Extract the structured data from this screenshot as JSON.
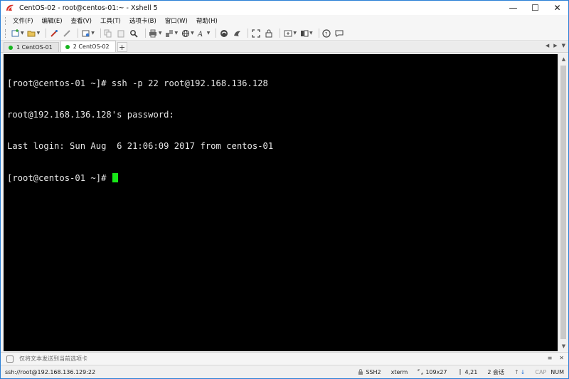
{
  "window": {
    "title": "CentOS-02 - root@centos-01:~ - Xshell 5",
    "controls": {
      "minimize": "—",
      "maximize": "☐",
      "close": "✕"
    }
  },
  "menu": [
    "文件(F)",
    "编辑(E)",
    "查看(V)",
    "工具(T)",
    "选项卡(B)",
    "窗口(W)",
    "帮助(H)"
  ],
  "toolbar": {
    "icons": [
      "new-session-icon",
      "open-folder-icon",
      "reconnect-icon",
      "disconnect-icon",
      "properties-icon",
      "copy-icon",
      "paste-icon",
      "find-icon",
      "print-icon",
      "transfer-icon",
      "globe-icon",
      "font-icon",
      "xftp-icon",
      "script-icon",
      "fullscreen-icon",
      "lock-icon",
      "new-tab-icon",
      "layout-icon",
      "help-icon",
      "chat-icon"
    ]
  },
  "tabs": [
    {
      "label": "1 CentOS-01",
      "status_color": "#16b51e",
      "active": false
    },
    {
      "label": "2 CentOS-02",
      "status_color": "#16b51e",
      "active": true
    }
  ],
  "terminal": {
    "lines": [
      "[root@centos-01 ~]# ssh -p 22 root@192.168.136.128",
      "root@192.168.136.128's password:",
      "Last login: Sun Aug  6 21:06:09 2017 from centos-01",
      "[root@centos-01 ~]# "
    ],
    "cursor_color": "#18e818"
  },
  "compose": {
    "placeholder": "仅将文本发送到当前选项卡"
  },
  "status": {
    "connection": "ssh://root@192.168.136.129:22",
    "protocol": "SSH2",
    "terminal_type": "xterm",
    "size": "109x27",
    "cursor_pos": "4,21",
    "sessions": "2 会话",
    "caps": "CAP",
    "num": "NUM"
  }
}
